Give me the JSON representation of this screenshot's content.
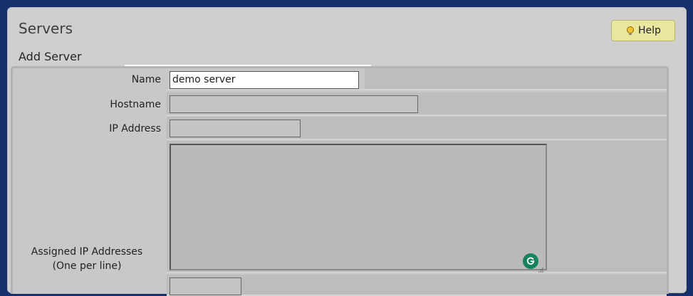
{
  "page": {
    "title": "Servers",
    "subtitle": "Add Server",
    "help_label": "Help"
  },
  "form": {
    "name_label": "Name",
    "name_value": "demo server",
    "hostname_label": "Hostname",
    "hostname_value": "",
    "ip_label": "IP Address",
    "ip_value": "",
    "assigned_label_line1": "Assigned IP Addresses",
    "assigned_label_line2": "(One per line)",
    "assigned_value": ""
  },
  "icons": {
    "help": "lightbulb-icon",
    "grammarly": "grammarly-icon",
    "resize": "resize-handle-icon"
  },
  "colors": {
    "background": "#16306b",
    "panel": "#cfcfcf",
    "help_button": "#e8e79d",
    "grammarly": "#15835c"
  }
}
